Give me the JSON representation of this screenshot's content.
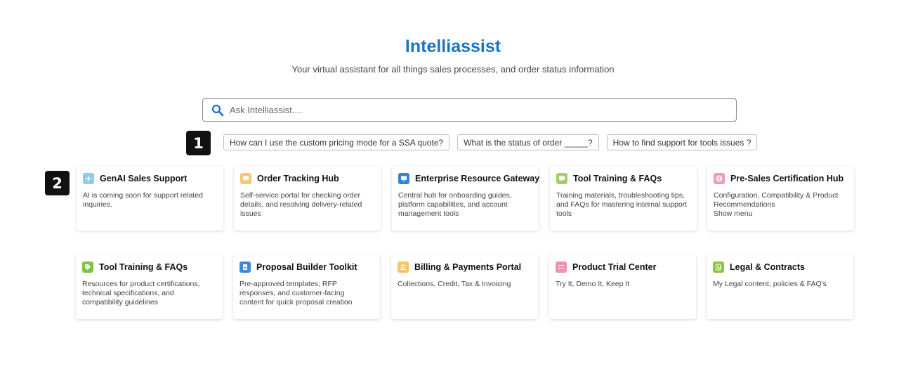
{
  "header": {
    "title": "Intelliassist",
    "subtitle": "Your virtual assistant for all things sales processes, and order status information"
  },
  "search": {
    "placeholder": "Ask Intelliassist...."
  },
  "markers": [
    "1",
    "2"
  ],
  "suggestions": [
    "How can I use the custom pricing mode for a SSA quote?",
    "What is the status of order _____?",
    "How to find support for tools issues ?"
  ],
  "cards": [
    {
      "title": "GenAI Sales Support",
      "description": "AI is coming soon for support related\ninquiries.",
      "icon": "sparkle-icon",
      "color": "#8ecbf2"
    },
    {
      "title": "Order Tracking Hub",
      "description": "Self-service portal for checking order\ndetails, and resolving delivery-related\nissues",
      "icon": "chat-icon",
      "color": "#f6c770"
    },
    {
      "title": "Enterprise Resource Gateway",
      "description": "Central hub for onboarding guides,\nplatform capabilities, and account\nmanagement tools",
      "icon": "monitor-icon",
      "color": "#2f86d6"
    },
    {
      "title": "Tool Training & FAQs",
      "description": "Training materials, troubleshooting tips,\nand FAQs for mastering internal support\ntools",
      "icon": "chat-icon",
      "color": "#a3d06a"
    },
    {
      "title": "Pre-Sales Certification Hub",
      "description": "Configuration, Compatibility & Product\nRecommendations\nShow menu",
      "icon": "globe-icon",
      "color": "#f29ab4"
    },
    {
      "title": "Tool Training & FAQs",
      "description": "Resources for product certifications,\ntechnical specifications, and\ncompatibility guidelines",
      "icon": "tag-icon",
      "color": "#7cc442"
    },
    {
      "title": "Proposal Builder Toolkit",
      "description": "Pre-approved templates, RFP\nresponses, and customer-facing\ncontent for quick proposal creation",
      "icon": "document-icon",
      "color": "#3c8ad8"
    },
    {
      "title": "Billing & Payments Portal",
      "description": "Collections, Credit, Tax & Invoicing",
      "icon": "bank-icon",
      "color": "#f5c56a"
    },
    {
      "title": "Product Trial Center",
      "description": "Try It, Demo It, Keep It",
      "icon": "checklist-icon",
      "color": "#f28fae"
    },
    {
      "title": "Legal & Contracts",
      "description": "My Legal content, policies & FAQ's",
      "icon": "contract-icon",
      "color": "#8cc63e"
    }
  ]
}
